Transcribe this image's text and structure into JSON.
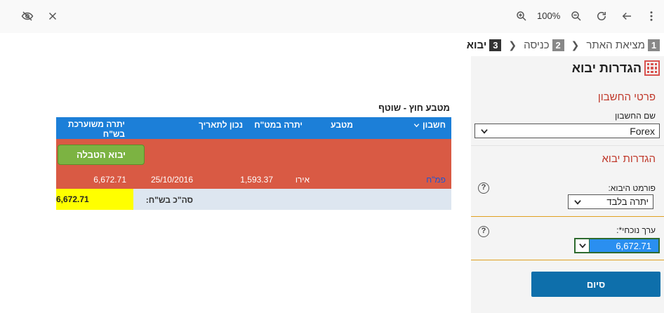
{
  "browser": {
    "zoom": "100%"
  },
  "breadcrumb": [
    {
      "num": "1",
      "label": "מציאת האתר"
    },
    {
      "num": "2",
      "label": "כניסה"
    },
    {
      "num": "3",
      "label": "יבוא"
    }
  ],
  "panel": {
    "title": "הגדרות יבוא",
    "account_section": "פרטי החשבון",
    "account_label": "שם החשבון",
    "account_value": "Forex",
    "import_section": "הגדרות יבוא",
    "format_label": "פורמט היבוא:",
    "format_value": "יתרה בלבד",
    "value_label": "ערך נוכחי*:",
    "value_value": "6,672.71",
    "help_glyph": "?",
    "finish_label": "סיום"
  },
  "table": {
    "caption": "מטבע חוץ - שוטף",
    "headers": {
      "account": "חשבון",
      "currency": "מטבע",
      "balance_fx": "יתרה במט\"ח",
      "date": "נכון לתאריך",
      "balance_ils": "יתרה משוערכת בש\"ח"
    },
    "import_button": "יבוא הטבלה",
    "row": {
      "account": "פמ\"ח",
      "currency": "אירו",
      "balance_fx": "1,593.37",
      "date": "25/10/2016",
      "balance_ils": "6,672.71"
    },
    "total_label": "סה\"כ בש\"ח:",
    "total_value": "6,672.71"
  },
  "colors": {
    "header_blue": "#1c7fd8",
    "row_red": "#d95a44",
    "button_green": "#7cb342",
    "total_yellow": "#ffff00",
    "finish_blue": "#0e6fab",
    "section_red": "#c0392b",
    "divider_orange": "#e0a020"
  }
}
